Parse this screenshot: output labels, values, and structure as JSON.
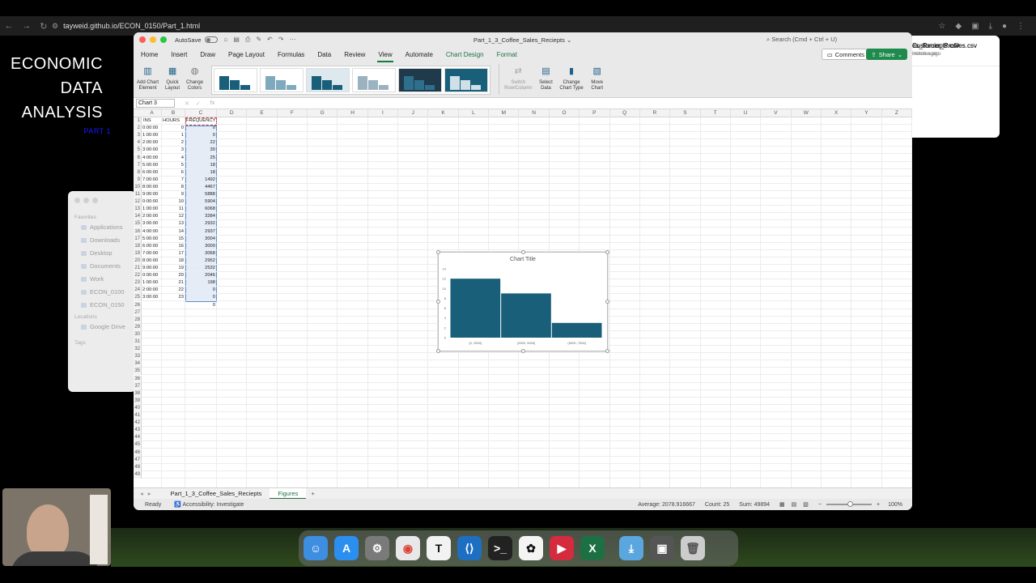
{
  "browser": {
    "url": "tayweid.github.io/ECON_0150/Part_1.html"
  },
  "slide": {
    "title_lines": [
      "ECONOMIC",
      "DATA",
      "ANALYSIS"
    ],
    "subtitle": "PART 1"
  },
  "finder": {
    "favorites_header": "Favorites",
    "favorites": [
      "Applications",
      "Downloads",
      "Desktop",
      "Documents",
      "Work",
      "ECON_0100",
      "ECON_0150"
    ],
    "locations_header": "Locations",
    "locations": [
      "Google Drive"
    ],
    "tags_header": "Tags"
  },
  "downloads": [
    {
      "name": "es_Reciepts.csv",
      "time": "inutes ago"
    },
    {
      "name": "es_Reciepts.csv",
      "time": "inutes ago"
    },
    {
      "name": "Customer_Profiles.csv",
      "time": "minutes ago"
    },
    {
      "name": "Customer_Profiles.csv",
      "time": "minutes ago"
    }
  ],
  "excel": {
    "autosave_label": "AutoSave",
    "doc_title": "Part_1_3_Coffee_Sales_Reciepts",
    "search_placeholder": "Search (Cmd + Ctrl + U)",
    "tabs": [
      "Home",
      "Insert",
      "Draw",
      "Page Layout",
      "Formulas",
      "Data",
      "Review",
      "View",
      "Automate",
      "Chart Design",
      "Format"
    ],
    "active_tab": "View",
    "comments_label": "Comments",
    "share_label": "Share",
    "ribbon": {
      "add_chart_element": [
        "Add Chart",
        "Element"
      ],
      "quick_layout": [
        "Quick",
        "Layout"
      ],
      "change_colors": [
        "Change",
        "Colors"
      ],
      "switch_row_column": [
        "Switch",
        "Row/Column"
      ],
      "select_data": [
        "Select",
        "Data"
      ],
      "change_chart_type": [
        "Change",
        "Chart Type"
      ],
      "move_chart": [
        "Move",
        "Chart"
      ]
    },
    "name_box": "Chart 3",
    "fx_label": "fx",
    "columns": [
      "A",
      "B",
      "C",
      "D",
      "E",
      "F",
      "G",
      "H",
      "I",
      "J",
      "K",
      "L",
      "M",
      "N",
      "O",
      "P",
      "Q",
      "R",
      "S",
      "T",
      "U",
      "V",
      "W",
      "X",
      "Y",
      "Z"
    ],
    "header_row": {
      "a": "INS",
      "b": "HOURS",
      "c": "FREQUENCY"
    },
    "data_rows": [
      {
        "a": "0:00:00",
        "b": "0",
        "c": "0"
      },
      {
        "a": "1:00:00",
        "b": "1",
        "c": "0"
      },
      {
        "a": "2:00:00",
        "b": "2",
        "c": "22"
      },
      {
        "a": "3:00:00",
        "b": "3",
        "c": "30"
      },
      {
        "a": "4:00:00",
        "b": "4",
        "c": "25"
      },
      {
        "a": "5:00:00",
        "b": "5",
        "c": "18"
      },
      {
        "a": "6:00:00",
        "b": "6",
        "c": "18"
      },
      {
        "a": "7:00:00",
        "b": "7",
        "c": "1492"
      },
      {
        "a": "8:00:00",
        "b": "8",
        "c": "4467"
      },
      {
        "a": "9:00:00",
        "b": "9",
        "c": "5888"
      },
      {
        "a": "0:00:00",
        "b": "10",
        "c": "5904"
      },
      {
        "a": "1:00:00",
        "b": "11",
        "c": "6068"
      },
      {
        "a": "2:00:00",
        "b": "12",
        "c": "3284"
      },
      {
        "a": "3:00:00",
        "b": "13",
        "c": "2932"
      },
      {
        "a": "4:00:00",
        "b": "14",
        "c": "2937"
      },
      {
        "a": "5:00:00",
        "b": "15",
        "c": "3004"
      },
      {
        "a": "6:00:00",
        "b": "16",
        "c": "3009"
      },
      {
        "a": "7:00:00",
        "b": "17",
        "c": "3068"
      },
      {
        "a": "8:00:00",
        "b": "18",
        "c": "2952"
      },
      {
        "a": "9:00:00",
        "b": "19",
        "c": "2532"
      },
      {
        "a": "0:00:00",
        "b": "20",
        "c": "2046"
      },
      {
        "a": "1:00:00",
        "b": "21",
        "c": "198"
      },
      {
        "a": "2:00:00",
        "b": "22",
        "c": "0"
      },
      {
        "a": "3:00:00",
        "b": "23",
        "c": "0"
      },
      {
        "a": "",
        "b": "",
        "c": "0"
      }
    ],
    "total_rows": 49,
    "sheet_tabs": [
      "Part_1_3_Coffee_Sales_Reciepts",
      "Figures"
    ],
    "active_sheet": "Figures",
    "status": {
      "ready": "Ready",
      "accessibility": "Accessibility: Investigate",
      "average": "Average: 2078.916667",
      "count": "Count: 25",
      "sum": "Sum: 49894",
      "zoom": "100%"
    },
    "colors": {
      "accent": "#1e7145",
      "bar": "#1a5f7a"
    }
  },
  "chart_data": {
    "type": "bar",
    "title": "Chart Title",
    "categories": [
      "[0, 2500]",
      "(2500, 5000]",
      "(5000, 7500]"
    ],
    "values": [
      12,
      9,
      3
    ],
    "ylim": [
      0,
      14
    ],
    "yticks": [
      0,
      2,
      4,
      6,
      8,
      10,
      12,
      14
    ],
    "xlabel": "",
    "ylabel": "",
    "grid": false,
    "color": "#1a5f7a"
  },
  "dock": [
    "Finder",
    "App Store",
    "System Settings",
    "Chrome",
    "Typora",
    "VS Code",
    "Terminal",
    "ChatGPT",
    "Zoom",
    "Excel",
    "Downloads",
    "Screenshots",
    "Trash"
  ]
}
